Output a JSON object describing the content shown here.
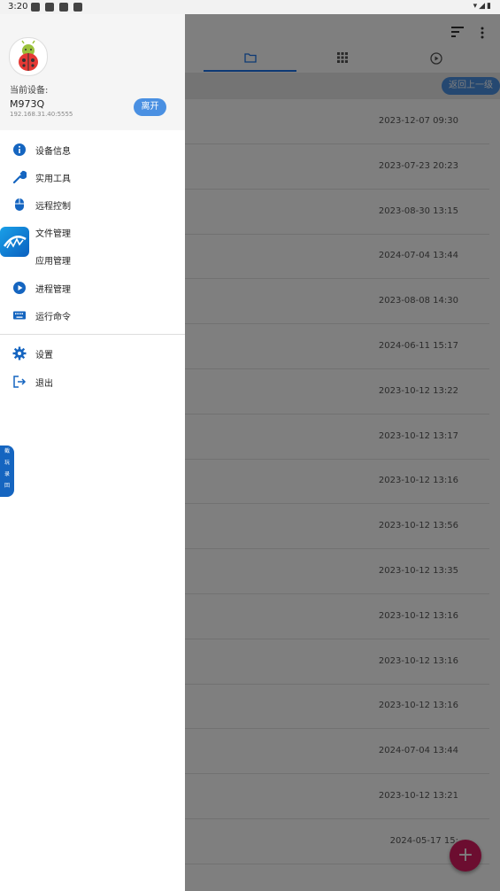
{
  "status_bar": {
    "time": "3:20"
  },
  "drawer": {
    "current_device_label": "当前设备:",
    "device_name": "M973Q",
    "device_ip": "192.168.31.40:5555",
    "leave_button": "离开",
    "menu_items": [
      {
        "label": "设备信息",
        "icon": "info-icon"
      },
      {
        "label": "实用工具",
        "icon": "wrench-icon"
      },
      {
        "label": "远程控制",
        "icon": "mouse-icon"
      },
      {
        "label": "文件管理",
        "icon": "folder-icon"
      },
      {
        "label": "应用管理",
        "icon": "apps-icon"
      },
      {
        "label": "进程管理",
        "icon": "play-circle-icon"
      },
      {
        "label": "运行命令",
        "icon": "keyboard-icon"
      }
    ],
    "bottom_items": [
      {
        "label": "设置",
        "icon": "gear-icon"
      },
      {
        "label": "退出",
        "icon": "logout-icon"
      }
    ]
  },
  "side_pill": [
    "截",
    "玩",
    "录",
    "回"
  ],
  "main": {
    "back_up_button": "返回上一级",
    "file_dates": [
      "2023-12-07 09:30",
      "2023-07-23 20:23",
      "2023-08-30 13:15",
      "2024-07-04 13:44",
      "2023-08-08 14:30",
      "2024-06-11 15:17",
      "2023-10-12 13:22",
      "2023-10-12 13:17",
      "2023-10-12 13:16",
      "2023-10-12 13:56",
      "2023-10-12 13:35",
      "2023-10-12 13:16",
      "2023-10-12 13:16",
      "2023-10-12 13:16",
      "2024-07-04 13:44",
      "2023-10-12 13:21",
      "2024-05-17 15:"
    ],
    "fab_label": "+"
  },
  "colors": {
    "accent": "#1a73e8",
    "button": "#4a90e2",
    "fab": "#d81b60"
  }
}
